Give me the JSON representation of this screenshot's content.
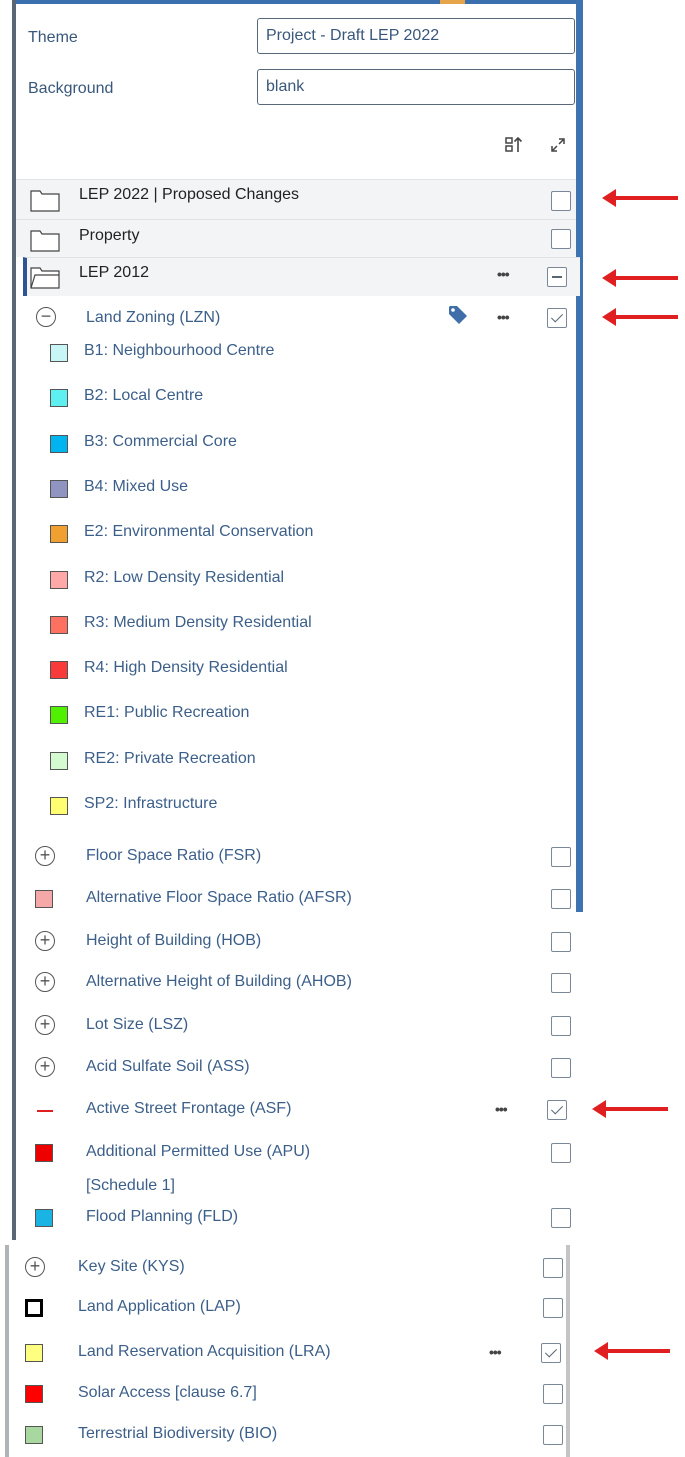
{
  "header": {
    "theme_label": "Theme",
    "theme_value": "Project - Draft LEP 2022",
    "background_label": "Background",
    "background_value": "blank"
  },
  "toolbar": {
    "sort_icon": "sort-icon",
    "expand_icon": "expand-icon"
  },
  "groups": [
    {
      "label": "LEP 2022 | Proposed Changes",
      "state": "unchecked"
    },
    {
      "label": "Property",
      "state": "unchecked"
    },
    {
      "label": "LEP 2012",
      "state": "partial"
    }
  ],
  "land_zoning": {
    "label": "Land Zoning (LZN)",
    "state": "checked",
    "legend": [
      {
        "label": "B1: Neighbourhood Centre",
        "color": "#c8f5f5"
      },
      {
        "label": "B2: Local Centre",
        "color": "#5ef0f0"
      },
      {
        "label": "B3: Commercial Core",
        "color": "#00b4f0"
      },
      {
        "label": "B4: Mixed Use",
        "color": "#9094c0"
      },
      {
        "label": "E2: Environmental Conservation",
        "color": "#f0a030"
      },
      {
        "label": "R2: Low Density Residential",
        "color": "#fea8a8"
      },
      {
        "label": "R3: Medium Density Residential",
        "color": "#fe7060"
      },
      {
        "label": "R4: High Density Residential",
        "color": "#f83a3a"
      },
      {
        "label": "RE1: Public Recreation",
        "color": "#50f000"
      },
      {
        "label": "RE2: Private Recreation",
        "color": "#d4fcd0"
      },
      {
        "label": "SP2: Infrastructure",
        "color": "#fefe70"
      }
    ]
  },
  "layers": [
    {
      "label": "Floor Space Ratio (FSR)",
      "icon": "plus-circle-icon",
      "state": "unchecked"
    },
    {
      "label": "Alternative Floor Space Ratio (AFSR)",
      "icon": "swatch",
      "color": "#f4a8a8",
      "state": "unchecked"
    },
    {
      "label": "Height of Building (HOB)",
      "icon": "plus-circle-icon",
      "state": "unchecked"
    },
    {
      "label": "Alternative Height of Building (AHOB)",
      "icon": "plus-circle-icon",
      "state": "unchecked"
    },
    {
      "label": "Lot Size (LSZ)",
      "icon": "plus-circle-icon",
      "state": "unchecked"
    },
    {
      "label": "Acid Sulfate Soil (ASS)",
      "icon": "plus-circle-icon",
      "state": "unchecked"
    },
    {
      "label": "Active Street Frontage (ASF)",
      "icon": "red-line-icon",
      "state": "checked"
    },
    {
      "label": "Additional Permitted Use (APU)",
      "label2": "[Schedule 1]",
      "icon": "swatch",
      "color": "#ee0000",
      "state": "unchecked"
    },
    {
      "label": "Flood Planning (FLD)",
      "icon": "swatch",
      "color": "#1ab4e4",
      "state": "unchecked"
    },
    {
      "label": "Key Site (KYS)",
      "icon": "plus-circle-icon",
      "state": "unchecked"
    },
    {
      "label": "Land Application (LAP)",
      "icon": "swatch",
      "color": "#ffffff",
      "state": "unchecked"
    },
    {
      "label": "Land Reservation Acquisition (LRA)",
      "icon": "swatch",
      "color": "#fefe80",
      "state": "checked"
    },
    {
      "label": "Solar Access [clause 6.7]",
      "icon": "swatch",
      "color": "#ff0000",
      "state": "unchecked"
    },
    {
      "label": "Terrestrial Biodiversity (BIO)",
      "icon": "swatch",
      "color": "#a8d8a0",
      "state": "unchecked"
    }
  ],
  "annotations": {
    "arrow_color": "#e02020"
  }
}
